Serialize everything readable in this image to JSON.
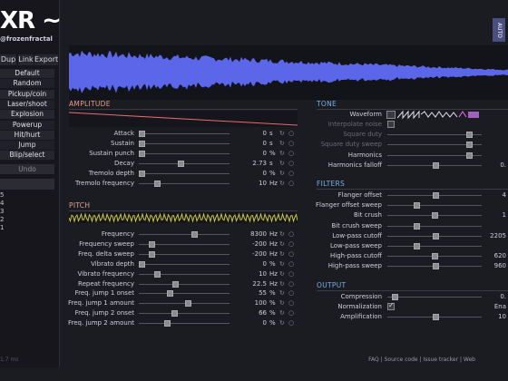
{
  "app": {
    "logo": "XR ~",
    "subtitle": "@frozenfractal",
    "auto_label": "AUTO",
    "version": "1.7 ms"
  },
  "top_buttons": [
    "Dup",
    "Link",
    "Export"
  ],
  "presets": [
    "Default",
    "Random",
    "Pickup/coin",
    "Laser/shoot",
    "Explosion",
    "Powerup",
    "Hit/hurt",
    "Jump",
    "Blip/select"
  ],
  "undo_label": "Undo",
  "history": [
    "5",
    "4",
    "3",
    "2",
    "1"
  ],
  "amplitude": {
    "title": "AMPLITUDE",
    "rows": [
      {
        "label": "Attack",
        "value": "0",
        "unit": "s",
        "level": 0.0
      },
      {
        "label": "Sustain",
        "value": "0",
        "unit": "s",
        "level": 0.0
      },
      {
        "label": "Sustain punch",
        "value": "0",
        "unit": "%",
        "level": 0.0
      },
      {
        "label": "Decay",
        "value": "2.73",
        "unit": "s",
        "level": 0.46
      },
      {
        "label": "Tremolo depth",
        "value": "0",
        "unit": "%",
        "level": 0.0
      },
      {
        "label": "Tremolo frequency",
        "value": "10",
        "unit": "Hz",
        "level": 0.18
      }
    ]
  },
  "pitch": {
    "title": "PITCH",
    "rows": [
      {
        "label": "Frequency",
        "value": "8300",
        "unit": "Hz",
        "level": 0.62
      },
      {
        "label": "Frequency sweep",
        "value": "-200",
        "unit": "Hz",
        "level": 0.12
      },
      {
        "label": "Freq. delta sweep",
        "value": "-200",
        "unit": "Hz",
        "level": 0.12
      },
      {
        "label": "Vibrato depth",
        "value": "0",
        "unit": "%",
        "level": 0.0
      },
      {
        "label": "Vibrato frequency",
        "value": "10",
        "unit": "Hz",
        "level": 0.18
      },
      {
        "label": "Repeat frequency",
        "value": "22.5",
        "unit": "Hz",
        "level": 0.4
      },
      {
        "label": "Freq. jump 1 onset",
        "value": "55",
        "unit": "%",
        "level": 0.33
      },
      {
        "label": "Freq. jump 1 amount",
        "value": "100",
        "unit": "%",
        "level": 0.55
      },
      {
        "label": "Freq. jump 2 onset",
        "value": "66",
        "unit": "%",
        "level": 0.39
      },
      {
        "label": "Freq. jump 2 amount",
        "value": "0",
        "unit": "%",
        "level": 0.3
      }
    ]
  },
  "tone": {
    "title": "TONE",
    "waveform_label": "Waveform",
    "rows": [
      {
        "label": "Interpolate noise",
        "value": "",
        "dim": true,
        "checkbox": true,
        "checked": false
      },
      {
        "label": "Square duty",
        "value": "",
        "dim": true,
        "level": 0.9
      },
      {
        "label": "Square duty sweep",
        "value": "",
        "dim": true,
        "level": 0.9
      },
      {
        "label": "Harmonics",
        "value": "",
        "level": 0.9
      },
      {
        "label": "Harmonics falloff",
        "value": "0.",
        "level": 0.52
      }
    ]
  },
  "filters": {
    "title": "FILTERS",
    "rows": [
      {
        "label": "Flanger offset",
        "value": "4",
        "level": 0.52
      },
      {
        "label": "Flanger offset sweep",
        "value": "",
        "level": 0.3
      },
      {
        "label": "Bit crush",
        "value": "1",
        "level": 0.5
      },
      {
        "label": "Bit crush sweep",
        "value": "",
        "level": 0.3
      },
      {
        "label": "Low-pass cutoff",
        "value": "2205",
        "level": 0.52
      },
      {
        "label": "Low-pass sweep",
        "value": "",
        "level": 0.3
      },
      {
        "label": "High-pass cutoff",
        "value": "620",
        "level": 0.5
      },
      {
        "label": "High-pass sweep",
        "value": "960",
        "level": 0.52
      }
    ]
  },
  "output": {
    "title": "OUTPUT",
    "rows": [
      {
        "label": "Compression",
        "value": "0.",
        "level": 0.05
      },
      {
        "label": "Normalization",
        "value": "Ena",
        "checkbox": true,
        "checked": true
      },
      {
        "label": "Amplification",
        "value": "10",
        "level": 0.52
      }
    ]
  },
  "footer": "FAQ | Source code | Issue tracker | Web"
}
